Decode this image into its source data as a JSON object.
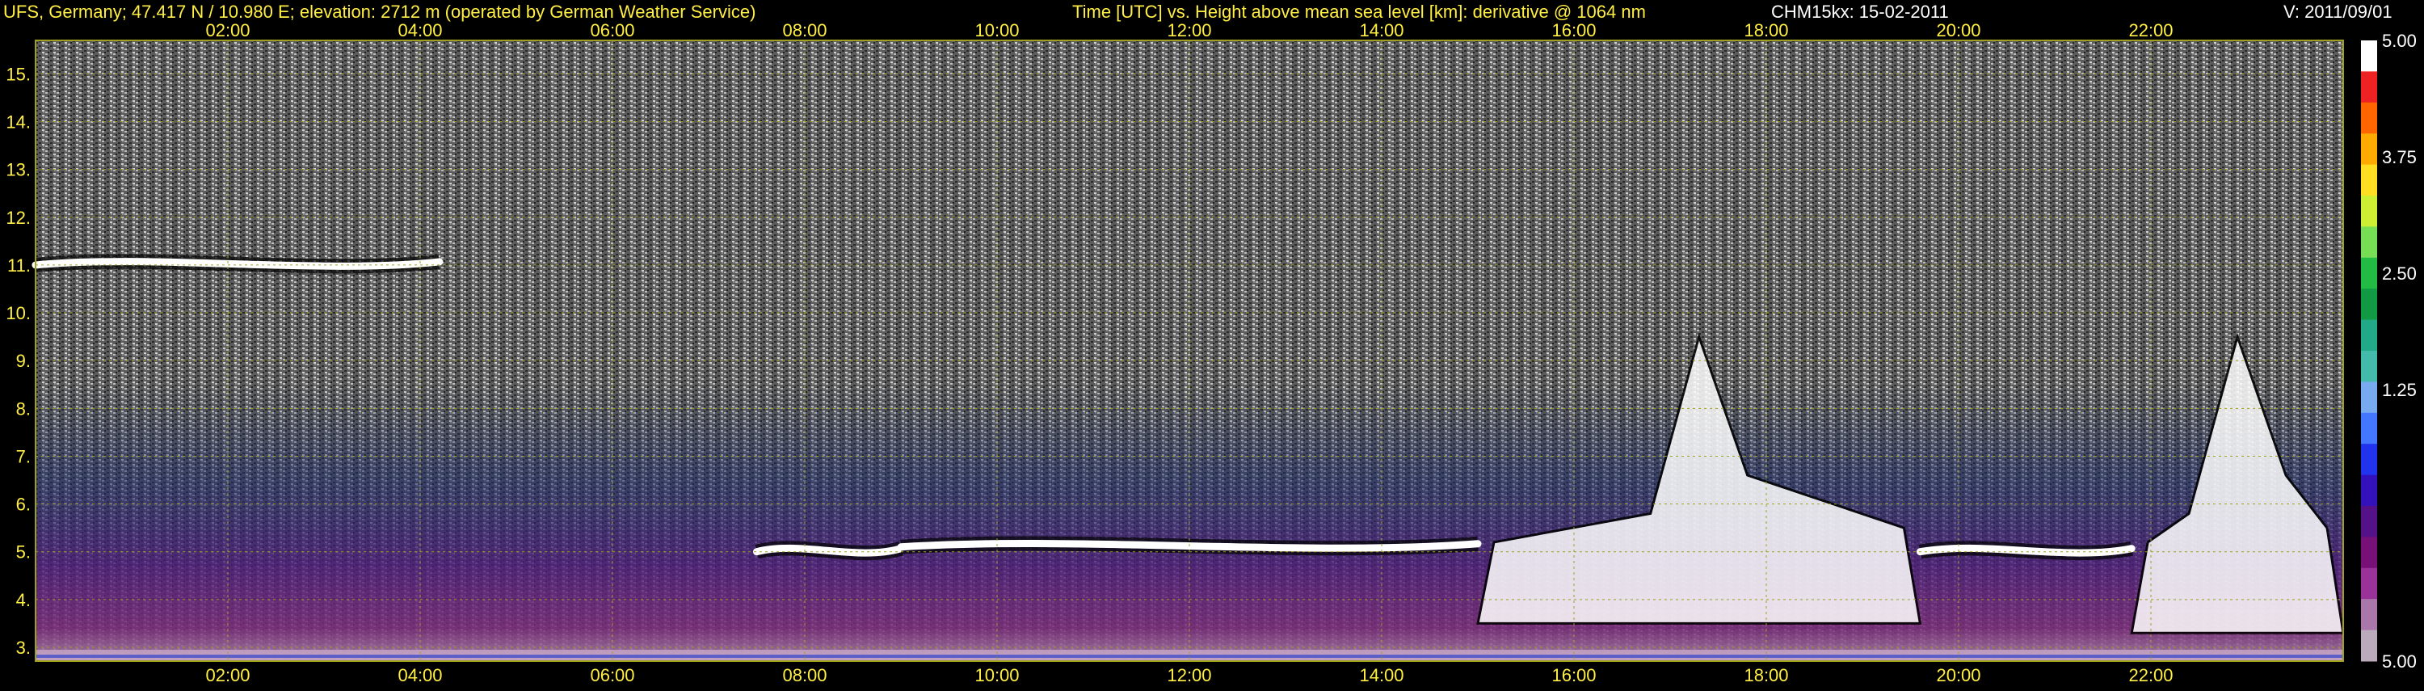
{
  "header": {
    "site": "UFS, Germany; 47.417 N / 10.980 E; elevation: 2712 m  (operated by German Weather Service)",
    "axes_desc": "Time [UTC] vs. Height above mean sea level [km]: derivative @ 1064 nm",
    "instrument": "CHM15kx: 15-02-2011",
    "version": "V: 2011/09/01"
  },
  "colors": {
    "text": "#ffee44",
    "grid": "#a0a020",
    "background": "#000000"
  },
  "chart_data": {
    "type": "heatmap",
    "title": "Time [UTC] vs. Height above mean sea level [km]: derivative @ 1064 nm",
    "xlabel": "Time [UTC]",
    "ylabel": "Height above mean sea level [km]",
    "x_unit": "hours UTC",
    "xlim": [
      0,
      24
    ],
    "ylim": [
      2.712,
      15.7
    ],
    "x_ticks": [
      {
        "value": 2,
        "label": "02:00"
      },
      {
        "value": 4,
        "label": "04:00"
      },
      {
        "value": 6,
        "label": "06:00"
      },
      {
        "value": 8,
        "label": "08:00"
      },
      {
        "value": 10,
        "label": "10:00"
      },
      {
        "value": 12,
        "label": "12:00"
      },
      {
        "value": 14,
        "label": "14:00"
      },
      {
        "value": 16,
        "label": "16:00"
      },
      {
        "value": 18,
        "label": "18:00"
      },
      {
        "value": 20,
        "label": "20:00"
      },
      {
        "value": 22,
        "label": "22:00"
      }
    ],
    "y_ticks": [
      {
        "value": 3,
        "label": "3."
      },
      {
        "value": 4,
        "label": "4."
      },
      {
        "value": 5,
        "label": "5."
      },
      {
        "value": 6,
        "label": "6."
      },
      {
        "value": 7,
        "label": "7."
      },
      {
        "value": 8,
        "label": "8."
      },
      {
        "value": 9,
        "label": "9."
      },
      {
        "value": 10,
        "label": "10."
      },
      {
        "value": 11,
        "label": "11."
      },
      {
        "value": 12,
        "label": "12."
      },
      {
        "value": 13,
        "label": "13."
      },
      {
        "value": 14,
        "label": "14."
      },
      {
        "value": 15,
        "label": "15."
      }
    ],
    "grid": true,
    "colorbar": {
      "ticks": [
        {
          "value": 5.0,
          "label": "5.00"
        },
        {
          "value": 3.75,
          "label": "3.75"
        },
        {
          "value": 2.5,
          "label": "2.50"
        },
        {
          "value": 1.25,
          "label": "1.25"
        },
        {
          "value": -5.0,
          "label": "5.00"
        }
      ],
      "colors_top_to_bottom": [
        "#ffffff",
        "#ee2222",
        "#ff6600",
        "#ffaa00",
        "#ffdd22",
        "#ccee33",
        "#77dd55",
        "#22bb44",
        "#119944",
        "#22aa88",
        "#44bbaa",
        "#77aaee",
        "#4477ff",
        "#2233ee",
        "#3311bb",
        "#551188",
        "#771177",
        "#993399",
        "#aa77aa",
        "#bbaabb"
      ]
    },
    "features": [
      {
        "name": "cirrus layer",
        "x_range": [
          0,
          4.2
        ],
        "y": 11.0
      },
      {
        "name": "cloud layer",
        "x_range": [
          7.5,
          9.0
        ],
        "y": 5.0
      },
      {
        "name": "cloud layer",
        "x_range": [
          9.0,
          15.0
        ],
        "y": 5.1
      },
      {
        "name": "convective cloud",
        "x_range": [
          15.0,
          19.6
        ],
        "y_range": [
          3.5,
          9.5
        ]
      },
      {
        "name": "cloud layer",
        "x_range": [
          19.6,
          21.8
        ],
        "y": 5.0
      },
      {
        "name": "convective cloud",
        "x_range": [
          21.8,
          24.0
        ],
        "y_range": [
          3.3,
          9.5
        ]
      }
    ]
  }
}
